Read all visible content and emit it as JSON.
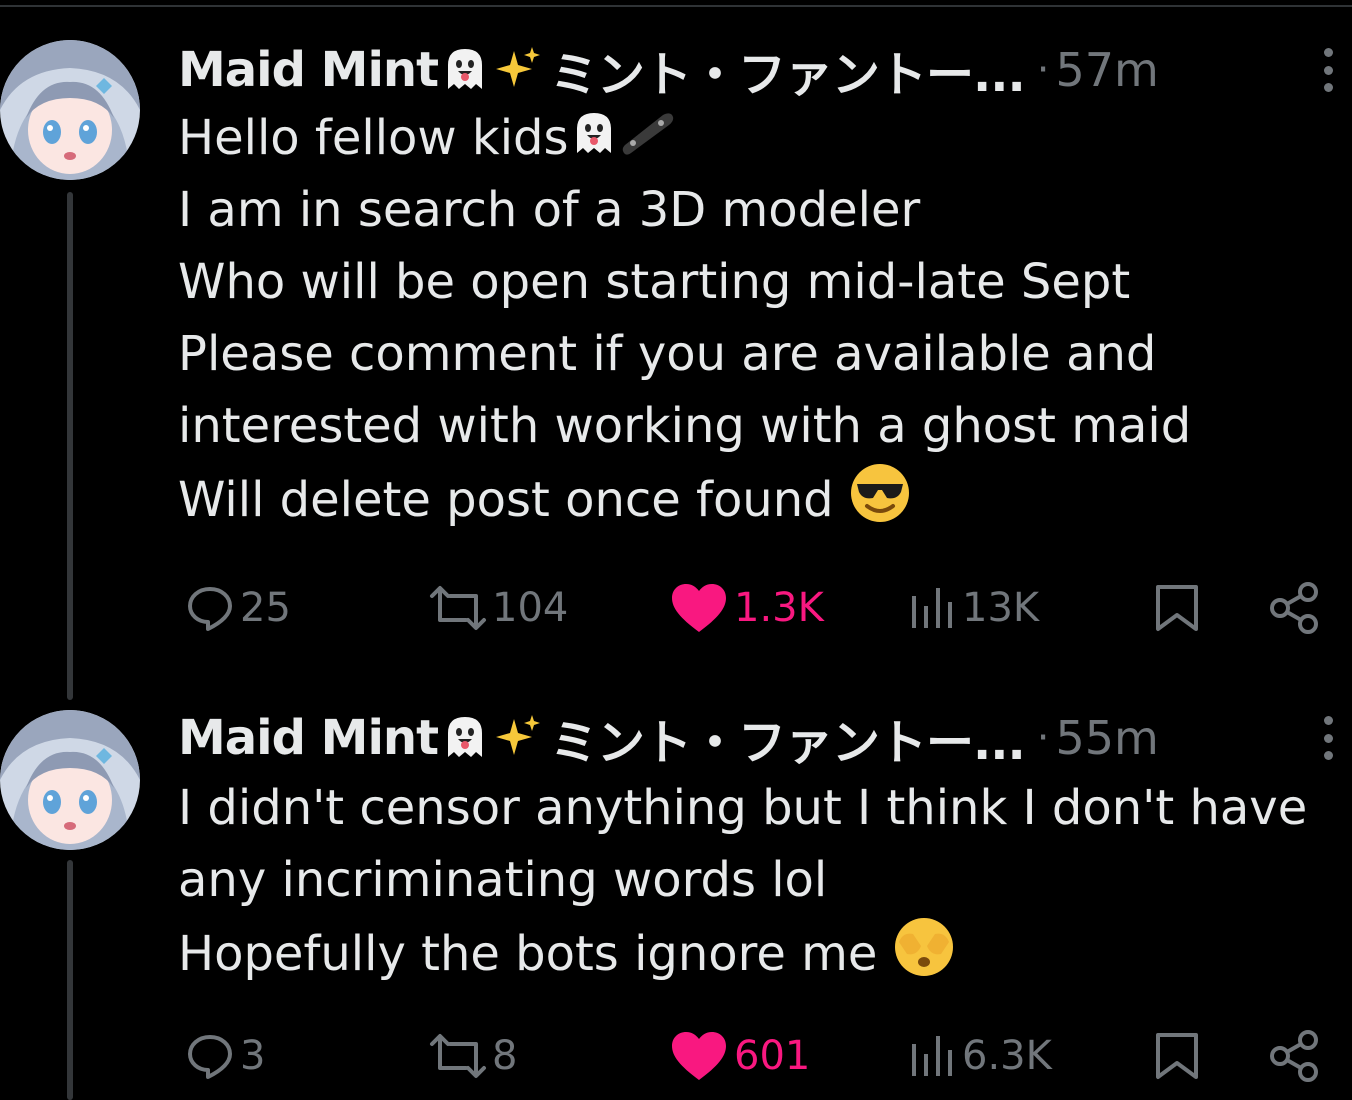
{
  "tweets": [
    {
      "author_name": "Maid Mint",
      "author_suffix": "ミント・ファントー...",
      "separator": "·",
      "time": "57m",
      "lines": [
        "Hello fellow kids",
        "I am in search of a 3D modeler",
        "Who will be open starting mid-late Sept",
        "Please comment if you are available and",
        "interested with working with a ghost maid",
        "Will delete post once found"
      ],
      "stats": {
        "replies": "25",
        "reposts": "104",
        "likes": "1.3K",
        "views": "13K"
      }
    },
    {
      "author_name": "Maid Mint",
      "author_suffix": "ミント・ファントー...",
      "separator": "·",
      "time": "55m",
      "lines": [
        "I didn't censor anything but I think I don't have",
        "any incriminating words lol",
        "Hopefully the bots ignore me"
      ],
      "stats": {
        "replies": "3",
        "reposts": "8",
        "likes": "601",
        "views": "6.3K"
      }
    }
  ],
  "icons": {
    "reply": "speech-bubble-icon",
    "repost": "repost-arrows-icon",
    "like": "heart-icon",
    "views": "bar-chart-icon",
    "bookmark": "bookmark-icon",
    "share": "share-icon",
    "more": "vertical-dots-icon"
  },
  "colors": {
    "background": "#000000",
    "text": "#e7e9ea",
    "muted": "#71767b",
    "like": "#f91880"
  }
}
